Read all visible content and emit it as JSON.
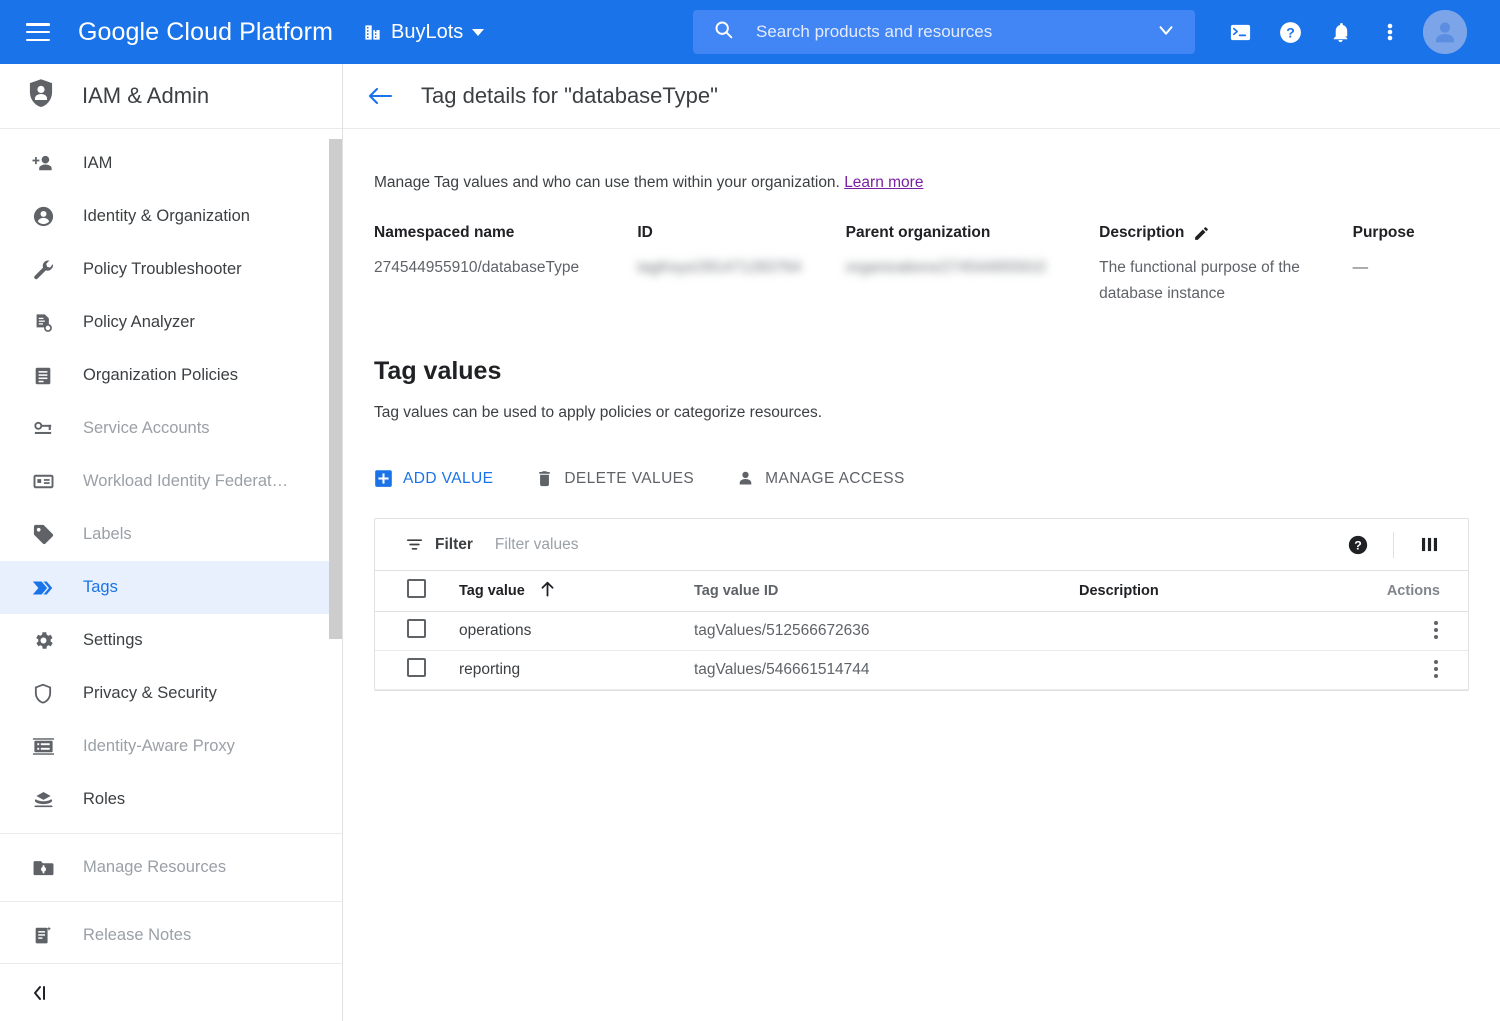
{
  "topbar": {
    "menu_icon": "hamburger-icon",
    "brand": "Google Cloud Platform",
    "project_icon": "building-icon",
    "project_name": "BuyLots",
    "search_placeholder": "Search products and resources",
    "search_value": "",
    "icons": [
      "cloud-shell-icon",
      "help-icon",
      "notifications-icon",
      "more-vert-icon",
      "account-avatar"
    ],
    "accent_color": "#1a73e8",
    "search_bg": "#4285f4"
  },
  "sidebar": {
    "header_icon": "iam-shield-person-icon",
    "header_title": "IAM & Admin",
    "items": [
      {
        "label": "IAM",
        "icon": "person-add-icon",
        "state": "normal"
      },
      {
        "label": "Identity & Organization",
        "icon": "account-circle-icon",
        "state": "normal"
      },
      {
        "label": "Policy Troubleshooter",
        "icon": "wrench-icon",
        "state": "normal"
      },
      {
        "label": "Policy Analyzer",
        "icon": "policy-document-icon",
        "state": "normal"
      },
      {
        "label": "Organization Policies",
        "icon": "list-document-icon",
        "state": "normal"
      },
      {
        "label": "Service Accounts",
        "icon": "key-card-icon",
        "state": "muted"
      },
      {
        "label": "Workload Identity Federat…",
        "icon": "id-card-icon",
        "state": "muted"
      },
      {
        "label": "Labels",
        "icon": "label-tag-icon",
        "state": "muted"
      },
      {
        "label": "Tags",
        "icon": "tags-chevron-icon",
        "state": "active"
      },
      {
        "label": "Settings",
        "icon": "gear-icon",
        "state": "normal"
      },
      {
        "label": "Privacy & Security",
        "icon": "shield-icon",
        "state": "normal"
      },
      {
        "label": "Identity-Aware Proxy",
        "icon": "proxy-icon",
        "state": "muted"
      },
      {
        "label": "Roles",
        "icon": "roles-hat-icon",
        "state": "normal"
      },
      {
        "label": "Manage Resources",
        "icon": "folder-settings-icon",
        "state": "muted"
      },
      {
        "label": "Release Notes",
        "icon": "release-notes-icon",
        "state": "muted"
      }
    ],
    "separator_after": [
      12,
      13
    ],
    "collapse_icon": "collapse-panel-icon",
    "active_bg": "#e8f0fe",
    "active_fg": "#1a73e8"
  },
  "main": {
    "back_icon": "arrow-back-icon",
    "title": "Tag details for \"databaseType\"",
    "intro_text": "Manage Tag values and who can use them within your organization.",
    "learn_more": "Learn more",
    "meta": [
      {
        "label": "Namespaced name",
        "value": "274544955910/databaseType",
        "redacted": false,
        "edit_icon": ""
      },
      {
        "label": "ID",
        "value": "tagKeys/281471283764",
        "redacted": true,
        "edit_icon": ""
      },
      {
        "label": "Parent organization",
        "value": "organizations/274544955910",
        "redacted": true,
        "edit_icon": ""
      },
      {
        "label": "Description",
        "value": "The functional purpose of the database instance",
        "redacted": false,
        "edit_icon": "edit-pencil-icon"
      },
      {
        "label": "Purpose",
        "value": "—",
        "redacted": false,
        "edit_icon": ""
      }
    ],
    "section_title": "Tag values",
    "section_subtitle": "Tag values can be used to apply policies or categorize resources.",
    "actions": [
      {
        "label": "ADD VALUE",
        "icon": "add-box-icon",
        "style": "primary"
      },
      {
        "label": "DELETE VALUES",
        "icon": "trash-icon",
        "style": "dim"
      },
      {
        "label": "MANAGE ACCESS",
        "icon": "person-icon",
        "style": "dim"
      }
    ],
    "filter": {
      "icon": "filter-list-icon",
      "label": "Filter",
      "placeholder": "Filter values",
      "value": "",
      "help_icon": "help-filled-icon",
      "columns_icon": "column-settings-icon"
    },
    "table": {
      "columns": [
        "Tag value",
        "Tag value ID",
        "Description",
        "Actions"
      ],
      "sort_column": "Tag value",
      "sort_direction": "ascending",
      "sort_icon": "arrow-up-icon",
      "header_checkbox_icon": "checkbox-unchecked-icon",
      "rows": [
        {
          "checked": false,
          "tag_value": "operations",
          "tag_value_id": "tagValues/512566672636",
          "description": "",
          "row_menu_icon": "more-vert-icon"
        },
        {
          "checked": false,
          "tag_value": "reporting",
          "tag_value_id": "tagValues/546661514744",
          "description": "",
          "row_menu_icon": "more-vert-icon"
        }
      ]
    }
  }
}
